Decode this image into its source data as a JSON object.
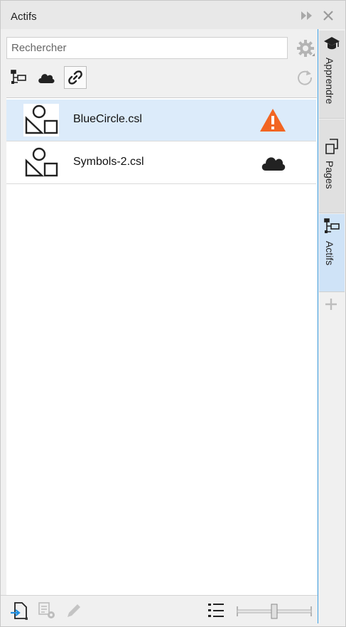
{
  "window": {
    "title": "Actifs"
  },
  "search": {
    "placeholder": "Rechercher"
  },
  "toolbar": {
    "icons": [
      "hierarchy-icon",
      "cloud-icon",
      "link-icon"
    ],
    "active": "link-icon"
  },
  "assets": [
    {
      "name": "BlueCircle.csl",
      "status": "warning",
      "selected": true
    },
    {
      "name": "Symbols-2.csl",
      "status": "cloud",
      "selected": false
    }
  ],
  "tabs": [
    {
      "label": "Apprendre",
      "icon": "graduation-cap-icon",
      "active": false
    },
    {
      "label": "Pages",
      "icon": "pages-icon",
      "active": false
    },
    {
      "label": "Actifs",
      "icon": "hierarchy-icon",
      "active": true
    }
  ],
  "colors": {
    "accent": "#3fa1e6",
    "selected_row": "#dcebfa",
    "warning": "#f26522"
  }
}
